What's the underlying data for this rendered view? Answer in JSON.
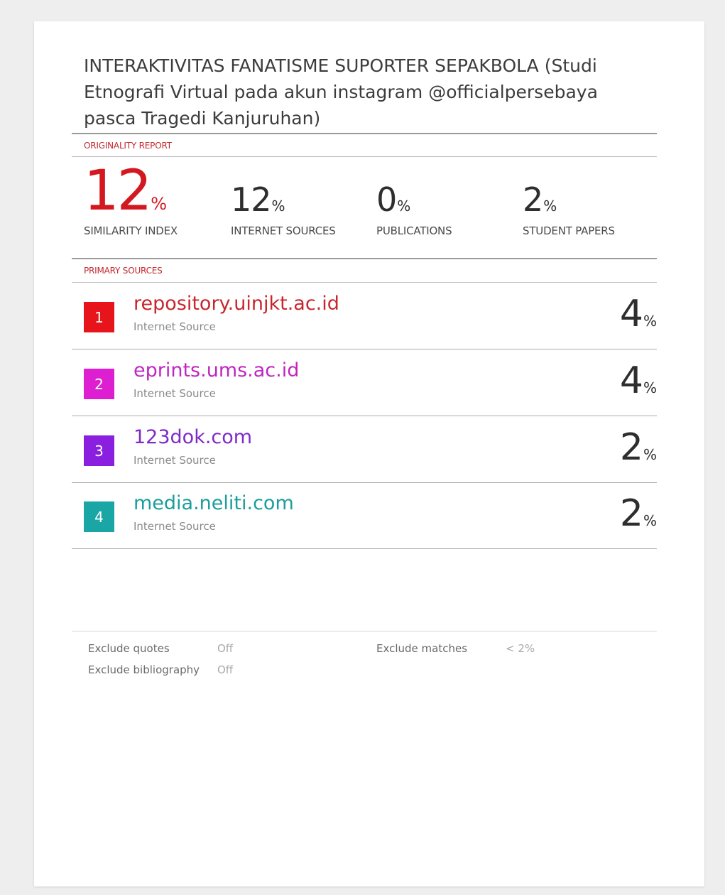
{
  "document": {
    "title": "INTERAKTIVITAS FANATISME SUPORTER SEPAKBOLA (Studi Etnografi Virtual pada akun instagram @officialpersebaya pasca Tragedi Kanjuruhan)"
  },
  "originality_report": {
    "label": "ORIGINALITY REPORT",
    "stats": [
      {
        "value": "12",
        "unit": "%",
        "label": "SIMILARITY INDEX"
      },
      {
        "value": "12",
        "unit": "%",
        "label": "INTERNET SOURCES"
      },
      {
        "value": "0",
        "unit": "%",
        "label": "PUBLICATIONS"
      },
      {
        "value": "2",
        "unit": "%",
        "label": "STUDENT PAPERS"
      }
    ]
  },
  "primary_sources": {
    "label": "PRIMARY SOURCES",
    "items": [
      {
        "rank": "1",
        "name": "repository.uinjkt.ac.id",
        "type": "Internet Source",
        "percent": "4",
        "unit": "%",
        "color": "#e8141c"
      },
      {
        "rank": "2",
        "name": "eprints.ums.ac.id",
        "type": "Internet Source",
        "percent": "4",
        "unit": "%",
        "color": "#dd1fd1"
      },
      {
        "rank": "3",
        "name": "123dok.com",
        "type": "Internet Source",
        "percent": "2",
        "unit": "%",
        "color": "#8a1fe0"
      },
      {
        "rank": "4",
        "name": "media.neliti.com",
        "type": "Internet Source",
        "percent": "2",
        "unit": "%",
        "color": "#1aa6a4"
      }
    ]
  },
  "settings": {
    "exclude_quotes_label": "Exclude quotes",
    "exclude_quotes_value": "Off",
    "exclude_bibliography_label": "Exclude bibliography",
    "exclude_bibliography_value": "Off",
    "exclude_matches_label": "Exclude matches",
    "exclude_matches_value": "< 2%"
  },
  "colors": {
    "accent_red": "#d4181f",
    "name_colors": [
      "#c8262c",
      "#c026c0",
      "#7e2bc8",
      "#1b9e9c"
    ]
  }
}
